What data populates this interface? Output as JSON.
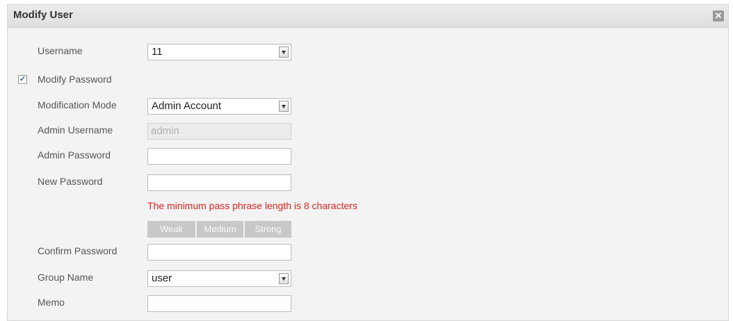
{
  "dialog": {
    "title": "Modify User",
    "close_icon": "close-icon"
  },
  "form": {
    "username_label": "Username",
    "username_value": "11",
    "modify_password_label": "Modify Password",
    "modify_password_checked": true,
    "modification_mode_label": "Modification Mode",
    "modification_mode_value": "Admin Account",
    "admin_username_label": "Admin Username",
    "admin_username_value": "admin",
    "admin_password_label": "Admin Password",
    "new_password_label": "New Password",
    "password_warning": "The minimum pass phrase length is 8 characters",
    "strength": [
      "Weak",
      "Medium",
      "Strong"
    ],
    "confirm_password_label": "Confirm Password",
    "group_name_label": "Group Name",
    "group_name_value": "user",
    "memo_label": "Memo"
  },
  "colors": {
    "warning": "#e8231f",
    "checkmark": "#2b5fb8"
  }
}
